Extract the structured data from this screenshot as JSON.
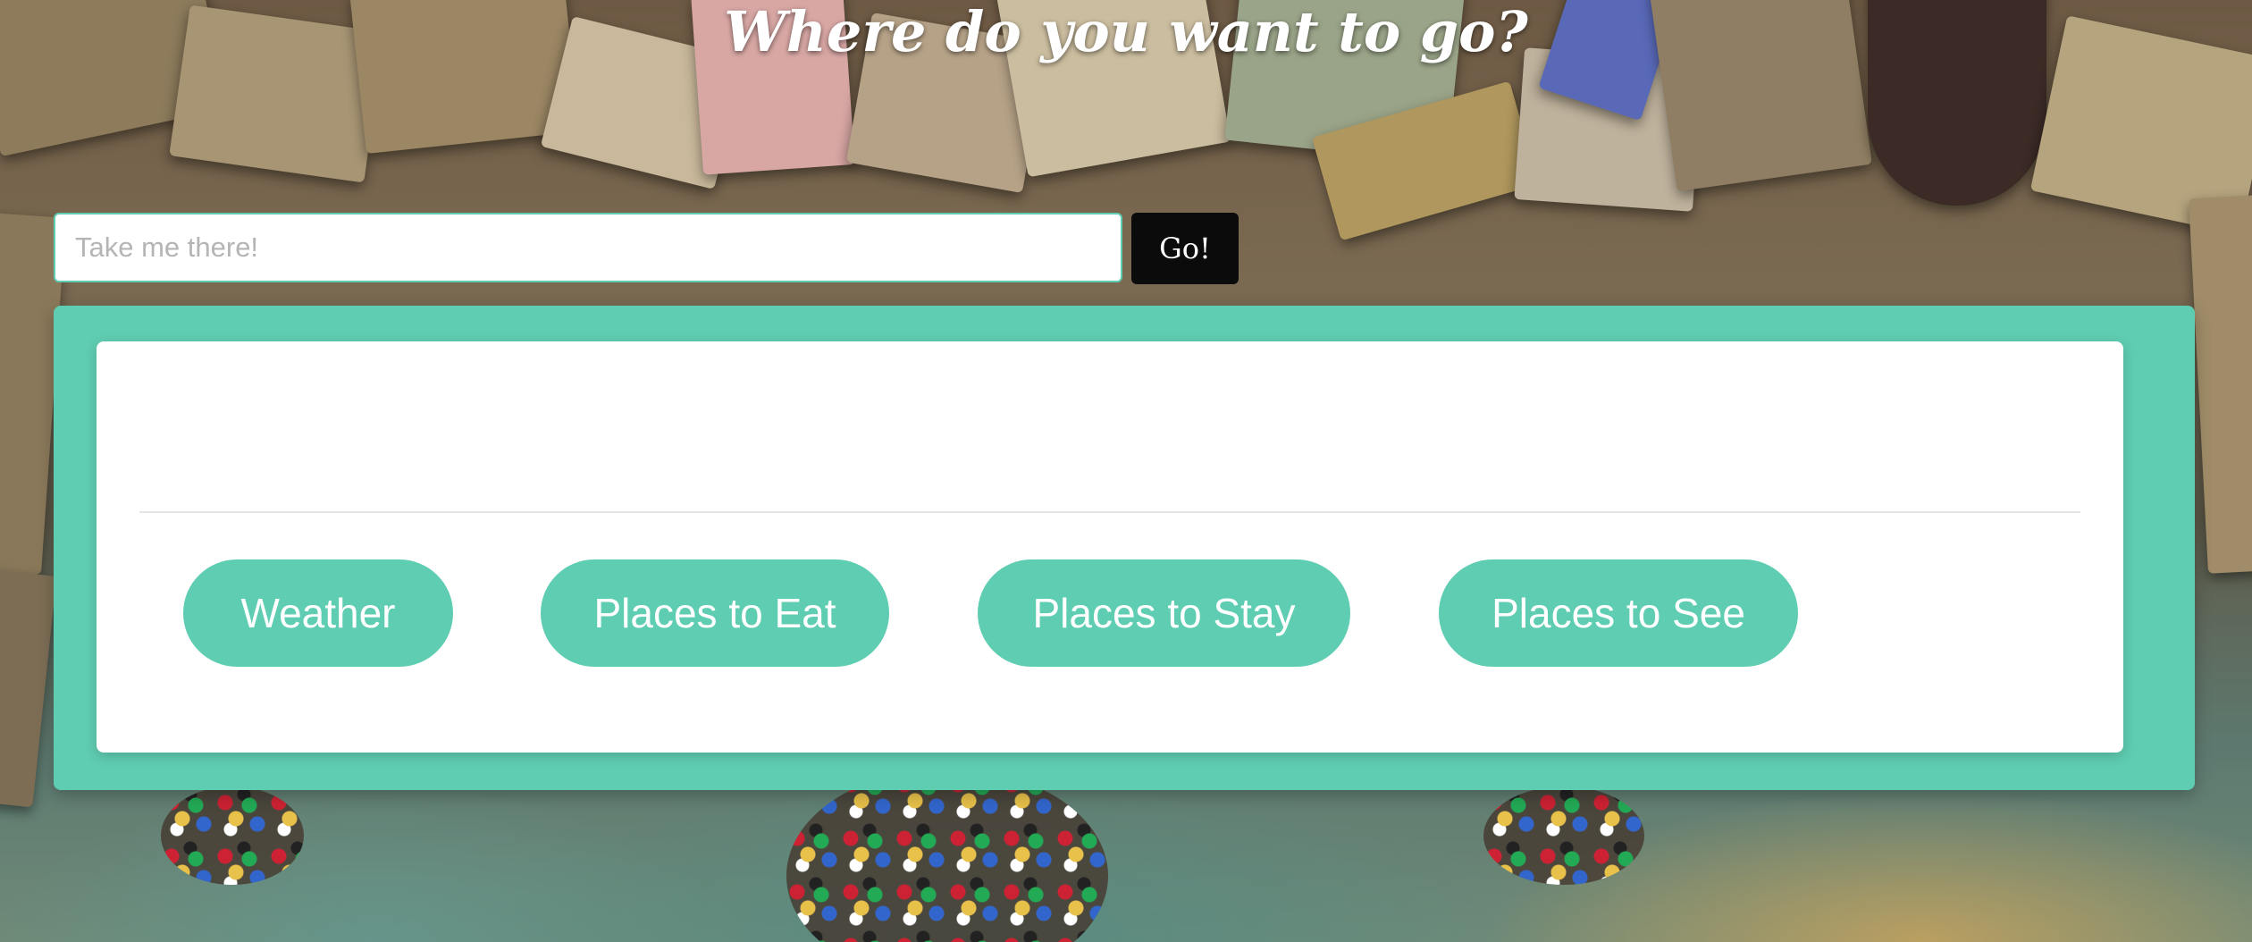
{
  "header": {
    "title": "Where do you want to go?"
  },
  "search": {
    "placeholder": "Take me there!",
    "value": "",
    "go_label": "Go!"
  },
  "result": {
    "text": ""
  },
  "categories": [
    {
      "label": "Weather"
    },
    {
      "label": "Places to Eat"
    },
    {
      "label": "Places to Stay"
    },
    {
      "label": "Places to See"
    }
  ],
  "colors": {
    "accent": "#5fcdb1",
    "go_button": "#0b0b0b",
    "card": "#ffffff"
  }
}
